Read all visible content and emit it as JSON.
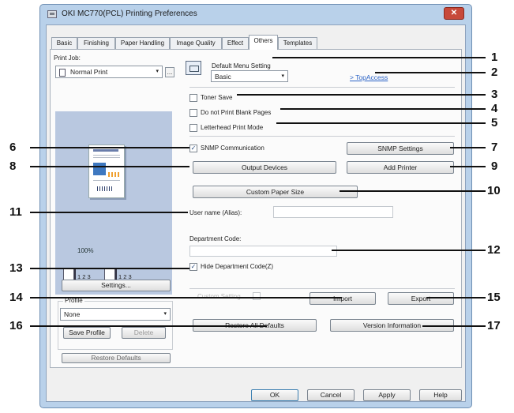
{
  "window": {
    "title": "OKI MC770(PCL) Printing Preferences",
    "close": "✕"
  },
  "tabs": [
    {
      "label": "Basic"
    },
    {
      "label": "Finishing"
    },
    {
      "label": "Paper Handling"
    },
    {
      "label": "Image Quality"
    },
    {
      "label": "Effect"
    },
    {
      "label": "Others"
    },
    {
      "label": "Templates"
    }
  ],
  "left": {
    "print_job_label": "Print Job:",
    "print_job_value": "Normal Print",
    "more_button": "...",
    "zoom": "100%",
    "mini_doc_1": "1 2 3",
    "mini_doc_2": "1 2 3",
    "settings_button": "Settings...",
    "profile_label": "Profile",
    "profile_value": "None",
    "save_profile_button": "Save Profile",
    "delete_button": "Delete",
    "restore_defaults_button": "Restore Defaults"
  },
  "right": {
    "default_menu_label": "Default Menu Setting",
    "default_menu_value": "Basic",
    "topaccess_link": "> TopAccess",
    "toner_save": "Toner Save",
    "no_blank_pages": "Do not Print Blank Pages",
    "letterhead_mode": "Letterhead Print Mode",
    "snmp_communication": "SNMP Communication",
    "snmp_checked": "✓",
    "snmp_settings_button": "SNMP Settings",
    "output_devices_button": "Output Devices",
    "add_printer_button": "Add Printer",
    "custom_paper_size_button": "Custom Paper Size",
    "user_name_label": "User name (Alias):",
    "department_code_label": "Department Code:",
    "hide_department_code": "Hide Department Code(Z)",
    "hide_checked": "✓",
    "custom_setting_label": "Custom Setting",
    "import_button": "Import",
    "export_button": "Export",
    "restore_all_defaults_button": "Restore All Defaults",
    "version_information_button": "Version Information"
  },
  "bottom": {
    "ok": "OK",
    "cancel": "Cancel",
    "apply": "Apply",
    "help": "Help"
  },
  "callouts": [
    "1",
    "2",
    "3",
    "4",
    "5",
    "6",
    "7",
    "8",
    "9",
    "10",
    "11",
    "12",
    "13",
    "14",
    "15",
    "16",
    "17"
  ],
  "icons": {
    "dropdown": "▾"
  }
}
